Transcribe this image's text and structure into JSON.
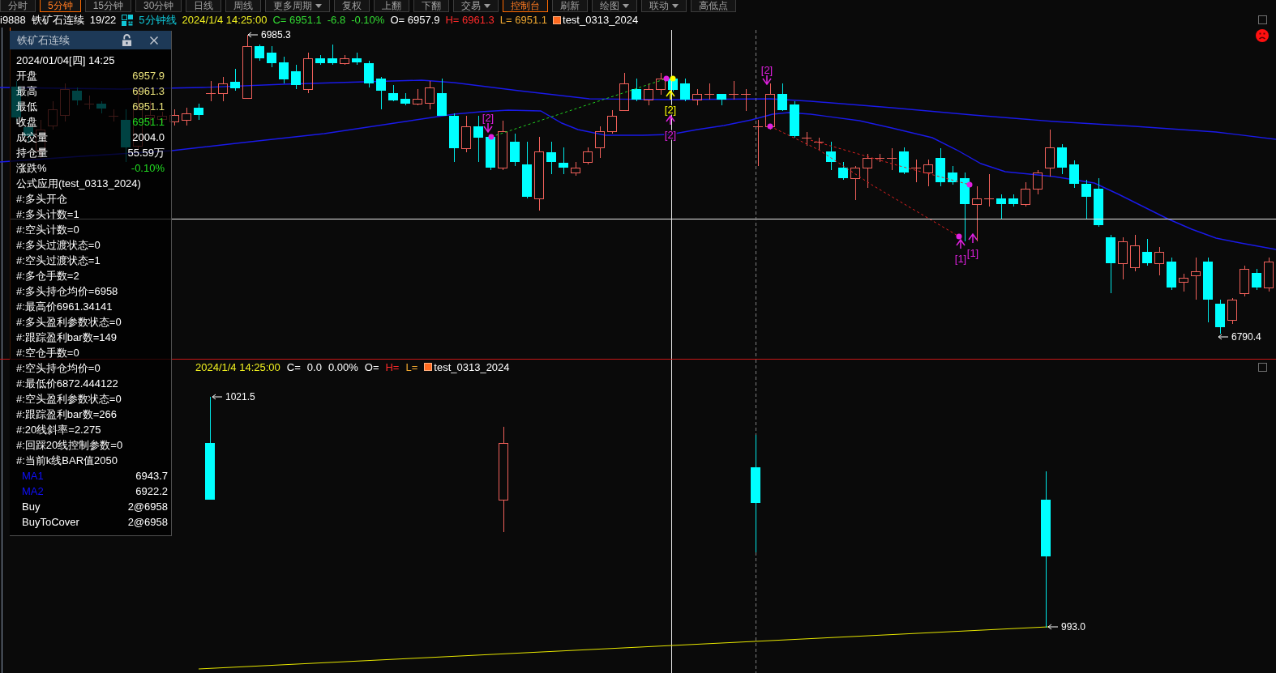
{
  "toolbar": [
    {
      "label": "分时",
      "selected": false,
      "dropdown": false
    },
    {
      "label": "5分钟",
      "selected": true,
      "dropdown": false
    },
    {
      "label": "15分钟",
      "selected": false,
      "dropdown": false
    },
    {
      "label": "30分钟",
      "selected": false,
      "dropdown": false
    },
    {
      "label": "日线",
      "selected": false,
      "dropdown": false
    },
    {
      "label": "周线",
      "selected": false,
      "dropdown": false
    },
    {
      "label": "更多周期",
      "selected": false,
      "dropdown": true
    },
    {
      "label": "复权",
      "selected": false,
      "dropdown": false
    },
    {
      "label": "上翻",
      "selected": false,
      "dropdown": false
    },
    {
      "label": "下翻",
      "selected": false,
      "dropdown": false
    },
    {
      "label": "交易",
      "selected": false,
      "dropdown": true
    },
    {
      "label": "控制台",
      "selected": true,
      "dropdown": false
    },
    {
      "label": "刷新",
      "selected": false,
      "dropdown": false
    },
    {
      "label": "绘图",
      "selected": false,
      "dropdown": true
    },
    {
      "label": "联动",
      "selected": false,
      "dropdown": true
    },
    {
      "label": "高低点",
      "selected": false,
      "dropdown": false
    }
  ],
  "header": {
    "symbol": "i9888",
    "name": "铁矿石连续",
    "count": "19/22",
    "period": "5分钟线",
    "datetime": "2024/1/4 14:25:00",
    "quote": [
      {
        "text": "C= 6951.1",
        "color": "#33dd33"
      },
      {
        "text": "-6.8",
        "color": "#33dd33"
      },
      {
        "text": "-0.10%",
        "color": "#33dd33"
      },
      {
        "text": "O= 6957.9",
        "color": "#ffffff"
      },
      {
        "text": "H= 6961.3",
        "color": "#ff2a2a"
      },
      {
        "text": "L= 6951.1",
        "color": "#f0a830"
      }
    ],
    "formula": "test_0313_2024"
  },
  "price_chart": {
    "high_label": "6985.3",
    "low_label": "6790.4",
    "signals": [
      {
        "kind": "down",
        "text": "[2]",
        "color": "#e020e0"
      },
      {
        "kind": "up",
        "text": "[2]",
        "color": "#ffff00"
      },
      {
        "kind": "up",
        "text": "[2]",
        "color": "#e020e0"
      },
      {
        "kind": "down",
        "text": "[2]",
        "color": "#e020e0"
      },
      {
        "kind": "up",
        "text": "[1]",
        "color": "#e020e0"
      },
      {
        "kind": "up",
        "text": "[1]",
        "color": "#e020e0"
      }
    ]
  },
  "lower_header": {
    "datetime": "2024/1/4 14:25:00",
    "quote": [
      {
        "text": "C=",
        "color": "#ffffff"
      },
      {
        "text": "0.0",
        "color": "#ffffff"
      },
      {
        "text": "0.00%",
        "color": "#ffffff"
      },
      {
        "text": "O=",
        "color": "#ffffff"
      },
      {
        "text": "H=",
        "color": "#ff2a2a"
      },
      {
        "text": "L=",
        "color": "#f0a830"
      }
    ],
    "formula": "test_0313_2024"
  },
  "lower_chart": {
    "high_label": "1021.5",
    "low_label": "993.0"
  },
  "info_panel": {
    "title": "铁矿石连续",
    "locked": false,
    "date": "2024/01/04[四] 14:25",
    "quotes": [
      {
        "label": "开盘",
        "value": "6957.9",
        "color": "#e8e07a"
      },
      {
        "label": "最高",
        "value": "6961.3",
        "color": "#e8e07a"
      },
      {
        "label": "最低",
        "value": "6951.1",
        "color": "#e8e07a"
      },
      {
        "label": "收盘",
        "value": "6951.1",
        "color": "#22dd22"
      },
      {
        "label": "成交量",
        "value": "2004.0",
        "color": "#ffffff"
      },
      {
        "label": "持仓量",
        "value": "55.59万",
        "color": "#ffffff"
      },
      {
        "label": "涨跌%",
        "value": "-0.10%",
        "color": "#22dd22"
      }
    ],
    "formula": "公式应用(test_0313_2024)",
    "params": [
      "#:多头开仓",
      "#:多头计数=1",
      "#:空头计数=0",
      "#:多头过渡状态=0",
      "#:空头过渡状态=1",
      "#:多仓手数=2",
      "#:多头持仓均价=6958",
      "#:最高价6961.34141",
      "#:多头盈利参数状态=0",
      "#:跟踪盈利bar数=149",
      "#:空仓手数=0",
      "#:空头持仓均价=0",
      "#:最低价6872.444122",
      "#:空头盈利参数状态=0",
      "#:跟踪盈利bar数=266",
      "#:20线斜率=2.275",
      "#:回踩20线控制参数=0",
      "#:当前k线BAR值2050"
    ],
    "indicators": [
      {
        "name": "MA1",
        "value": "6943.7",
        "color": "#1010ff"
      },
      {
        "name": "MA2",
        "value": "6922.2",
        "color": "#1010ff"
      },
      {
        "name": "Buy",
        "value": "2@6958",
        "color": "#ffffff"
      },
      {
        "name": "BuyToCover",
        "value": "2@6958",
        "color": "#ffffff"
      }
    ]
  }
}
